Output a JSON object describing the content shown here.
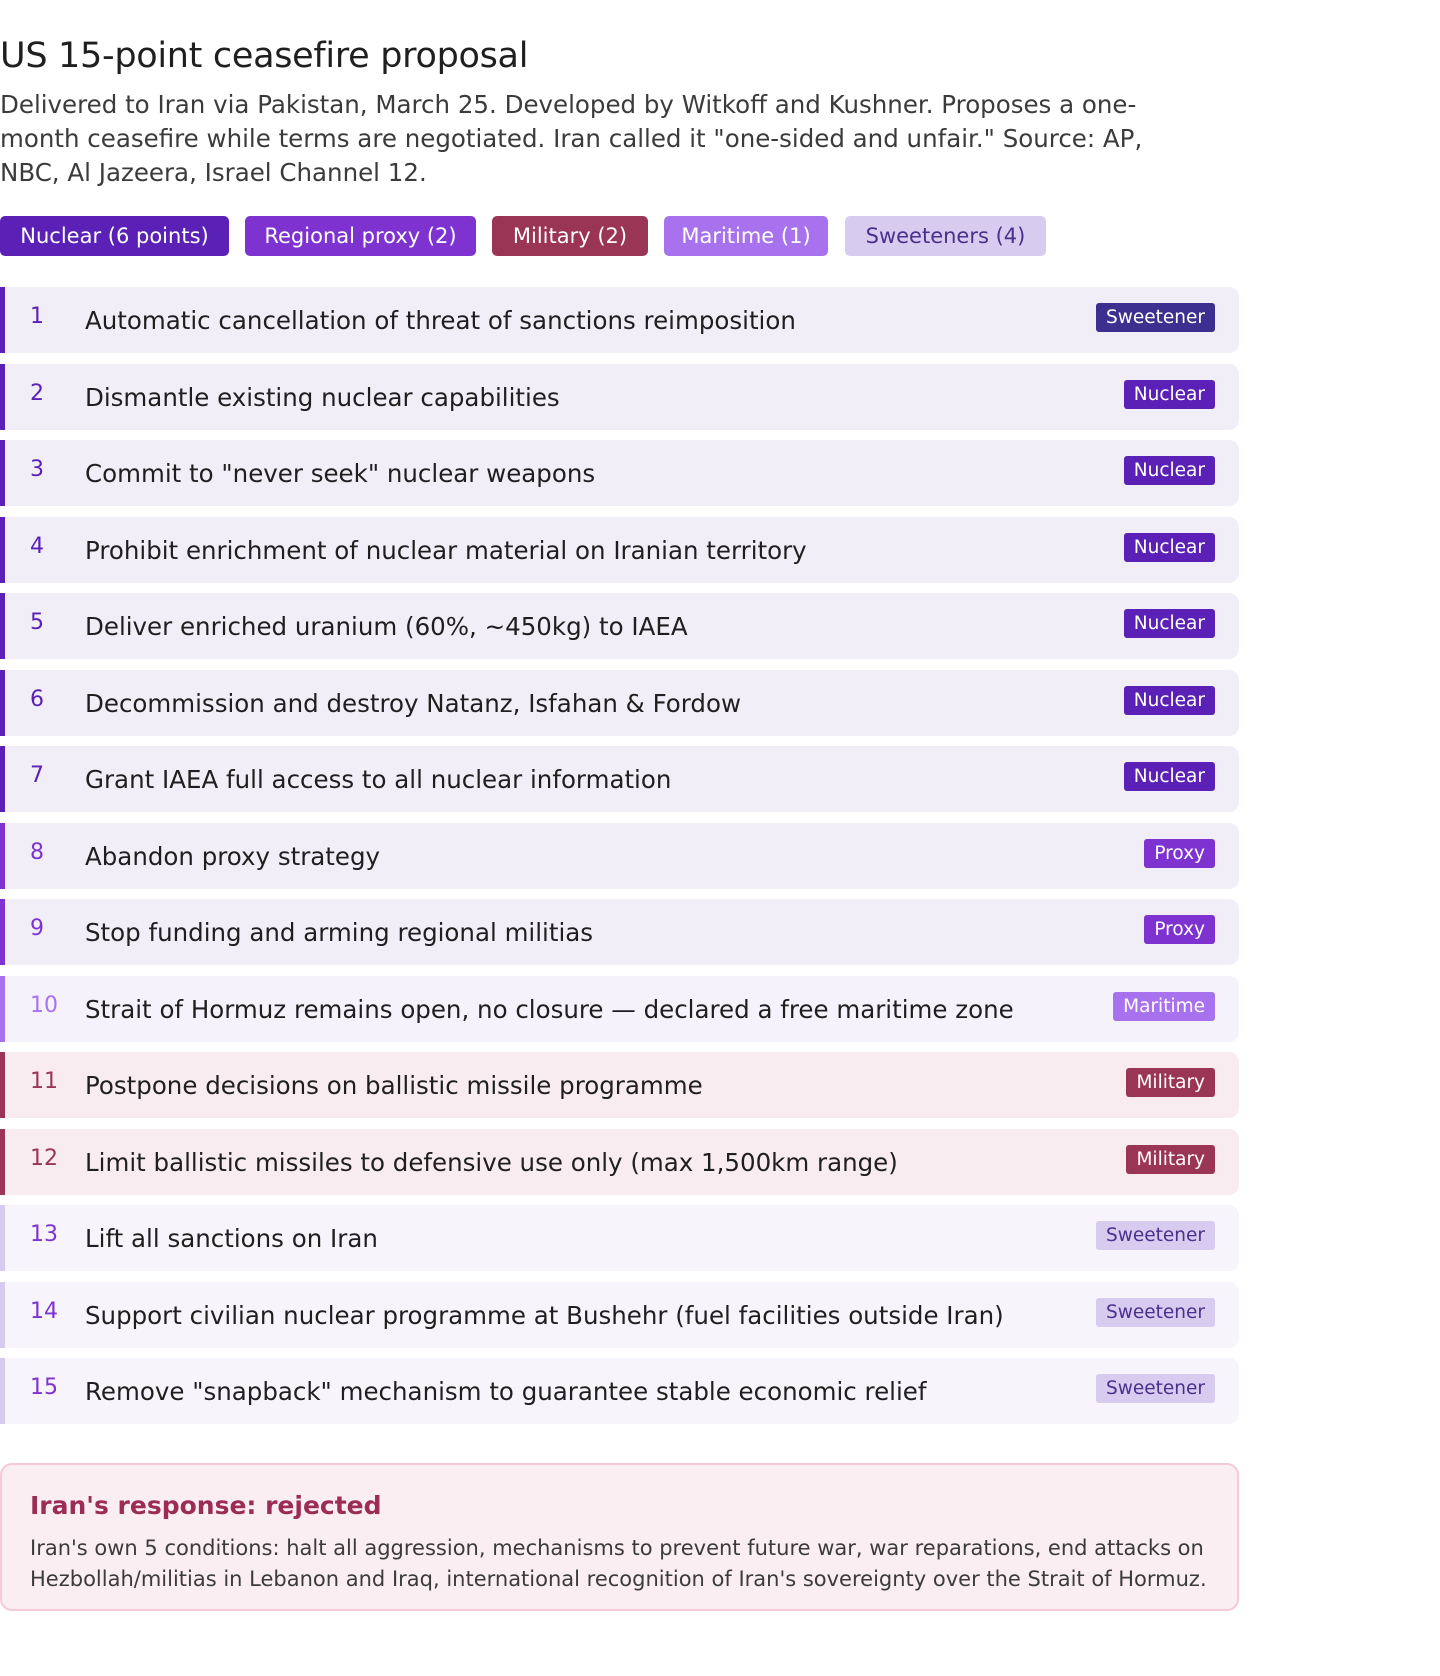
{
  "title": "US 15-point ceasefire proposal",
  "subtitle": "Delivered to Iran via Pakistan, March 25. Developed by Witkoff and Kushner. Proposes a one-month ceasefire while terms are negotiated. Iran called it \"one-sided and unfair.\" Source: AP, NBC, Al Jazeera, Israel Channel 12.",
  "filters": [
    {
      "label": "Nuclear (6 points)",
      "bg": "#5b21b6",
      "fg": "#ffffff"
    },
    {
      "label": "Regional proxy (2)",
      "bg": "#7e32d0",
      "fg": "#ffffff"
    },
    {
      "label": "Military (2)",
      "bg": "#9b3556",
      "fg": "#ffffff"
    },
    {
      "label": "Maritime (1)",
      "bg": "#a872ee",
      "fg": "#ffffff"
    },
    {
      "label": "Sweeteners (4)",
      "bg": "#d8cbf0",
      "fg": "#4b2f8c"
    }
  ],
  "categories": {
    "nuclear": {
      "tag_bg": "#5b21b6",
      "tag_fg": "#ffffff",
      "row_bg": "#f1eef7",
      "accent": "#5b21b6",
      "num_color": "#5b21b6"
    },
    "proxy": {
      "tag_bg": "#7e32d0",
      "tag_fg": "#ffffff",
      "row_bg": "#f1eef7",
      "accent": "#7e32d0",
      "num_color": "#7e32d0"
    },
    "maritime": {
      "tag_bg": "#a872ee",
      "tag_fg": "#ffffff",
      "row_bg": "#f5f2fb",
      "accent": "#a872ee",
      "num_color": "#a872ee"
    },
    "military": {
      "tag_bg": "#9b3556",
      "tag_fg": "#ffffff",
      "row_bg": "#f8ecf0",
      "accent": "#9b3556",
      "num_color": "#9b3556"
    },
    "sweetener_dark": {
      "tag_bg": "#3d2f8f",
      "tag_fg": "#ffffff",
      "row_bg": "#f1eef7",
      "accent": "#5b21b6",
      "num_color": "#5b21b6"
    },
    "sweetener_light": {
      "tag_bg": "#d8cbf0",
      "tag_fg": "#4b2f8c",
      "row_bg": "#f7f5fb",
      "accent": "#d8cbf0",
      "num_color": "#7e32d0"
    }
  },
  "points": [
    {
      "num": "1",
      "text": "Automatic cancellation of threat of sanctions reimposition",
      "tag": "Sweetener",
      "cat": "sweetener_dark"
    },
    {
      "num": "2",
      "text": "Dismantle existing nuclear capabilities",
      "tag": "Nuclear",
      "cat": "nuclear"
    },
    {
      "num": "3",
      "text": "Commit to \"never seek\" nuclear weapons",
      "tag": "Nuclear",
      "cat": "nuclear"
    },
    {
      "num": "4",
      "text": "Prohibit enrichment of nuclear material on Iranian territory",
      "tag": "Nuclear",
      "cat": "nuclear"
    },
    {
      "num": "5",
      "text": "Deliver enriched uranium (60%, ~450kg) to IAEA",
      "tag": "Nuclear",
      "cat": "nuclear"
    },
    {
      "num": "6",
      "text": "Decommission and destroy Natanz, Isfahan & Fordow",
      "tag": "Nuclear",
      "cat": "nuclear"
    },
    {
      "num": "7",
      "text": "Grant IAEA full access to all nuclear information",
      "tag": "Nuclear",
      "cat": "nuclear"
    },
    {
      "num": "8",
      "text": "Abandon proxy strategy",
      "tag": "Proxy",
      "cat": "proxy"
    },
    {
      "num": "9",
      "text": "Stop funding and arming regional militias",
      "tag": "Proxy",
      "cat": "proxy"
    },
    {
      "num": "10",
      "text": "Strait of Hormuz remains open, no closure — declared a free maritime zone",
      "tag": "Maritime",
      "cat": "maritime"
    },
    {
      "num": "11",
      "text": "Postpone decisions on ballistic missile programme",
      "tag": "Military",
      "cat": "military"
    },
    {
      "num": "12",
      "text": "Limit ballistic missiles to defensive use only (max 1,500km range)",
      "tag": "Military",
      "cat": "military"
    },
    {
      "num": "13",
      "text": "Lift all sanctions on Iran",
      "tag": "Sweetener",
      "cat": "sweetener_light"
    },
    {
      "num": "14",
      "text": "Support civilian nuclear programme at Bushehr (fuel facilities outside Iran)",
      "tag": "Sweetener",
      "cat": "sweetener_light"
    },
    {
      "num": "15",
      "text": "Remove \"snapback\" mechanism to guarantee stable economic relief",
      "tag": "Sweetener",
      "cat": "sweetener_light"
    }
  ],
  "response": {
    "title": "Iran's response: rejected",
    "body": "Iran's own 5 conditions: halt all aggression, mechanisms to prevent future war, war reparations, end attacks on Hezbollah/militias in Lebanon and Iraq, international recognition of Iran's sovereignty over the Strait of Hormuz."
  }
}
